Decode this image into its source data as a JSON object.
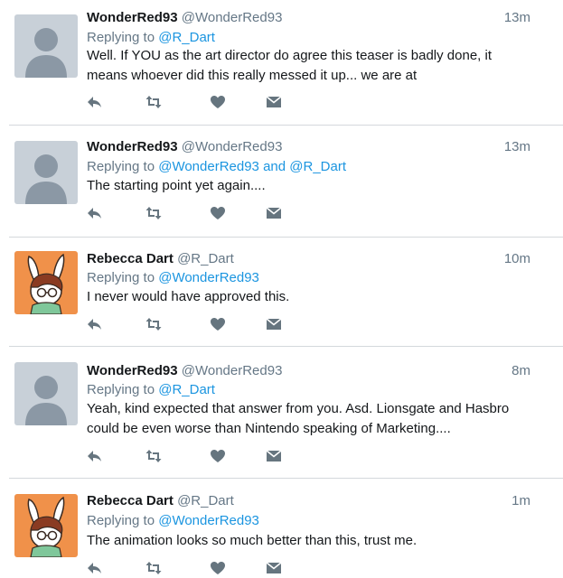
{
  "tweets": [
    {
      "name": "WonderRed93",
      "handle": "@WonderRed93",
      "time": "13m",
      "replying_prefix": "Replying to",
      "replying_to": "@R_Dart",
      "replying_and": "",
      "replying_to2": "",
      "text": "Well. If YOU as the art director do agree this teaser is badly done, it means whoever did this really messed it up... we are at",
      "avatar": "default-avatar"
    },
    {
      "name": "WonderRed93",
      "handle": "@WonderRed93",
      "time": "13m",
      "replying_prefix": "Replying to",
      "replying_to": "@WonderRed93",
      "replying_and": "and",
      "replying_to2": "@R_Dart",
      "text": "The starting point yet again....",
      "avatar": "default-avatar"
    },
    {
      "name": "Rebecca Dart",
      "handle": "@R_Dart",
      "time": "10m",
      "replying_prefix": "Replying to",
      "replying_to": "@WonderRed93",
      "replying_and": "",
      "replying_to2": "",
      "text": "I never would have approved this.",
      "avatar": "bunny-avatar"
    },
    {
      "name": "WonderRed93",
      "handle": "@WonderRed93",
      "time": "8m",
      "replying_prefix": "Replying to",
      "replying_to": "@R_Dart",
      "replying_and": "",
      "replying_to2": "",
      "text": "Yeah, kind expected that answer from you. Asd. Lionsgate and Hasbro could be even worse than Nintendo speaking of Marketing....",
      "avatar": "default-avatar"
    },
    {
      "name": "Rebecca Dart",
      "handle": "@R_Dart",
      "time": "1m",
      "replying_prefix": "Replying to",
      "replying_to": "@WonderRed93",
      "replying_and": "",
      "replying_to2": "",
      "text": "The animation looks so much better than this, trust me.",
      "avatar": "bunny-avatar"
    }
  ],
  "action_icons": [
    "reply-icon",
    "retweet-icon",
    "like-icon",
    "direct-message-icon"
  ],
  "colors": {
    "link": "#1b95e0",
    "muted": "#657786",
    "icon": "#66757f",
    "divider": "#d4d8dc",
    "default_avatar_bg": "#c8d0d8",
    "default_avatar_fg": "#8b98a5",
    "bunny_avatar_bg": "#f0914a"
  }
}
